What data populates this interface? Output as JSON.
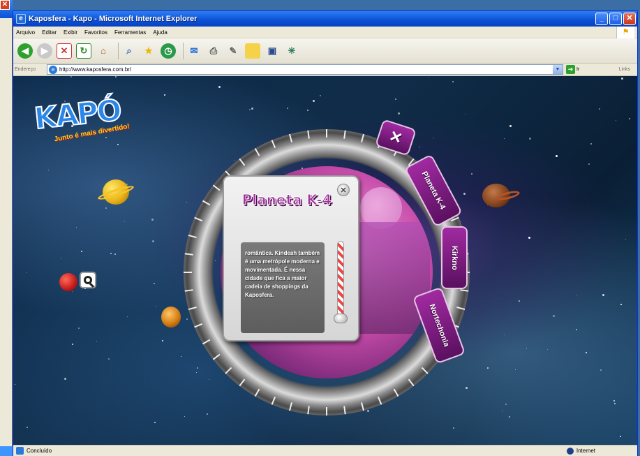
{
  "window": {
    "title": "Kaposfera - Kapo - Microsoft Internet Explorer",
    "minimize": "_",
    "maximize": "□",
    "close": "✕"
  },
  "menu": [
    "Arquivo",
    "Editar",
    "Exibir",
    "Favoritos",
    "Ferramentas",
    "Ajuda"
  ],
  "address": {
    "label": "Endereço",
    "url": "http://www.kaposfera.com.br/",
    "go_label": "Ir",
    "links_label": "Links"
  },
  "page": {
    "logo_word": "KAPÓ",
    "logo_tagline": "Junto é mais divertido!",
    "tabs": {
      "close": "✕",
      "planeta": "Planeta K-4",
      "kirkno": "Kirkno",
      "nortechonia": "Nortechonia"
    },
    "panel": {
      "title": "Planeta K-4",
      "close": "✕",
      "text": "romântica. Kindeah também é uma metrópole moderna e movimentada. É nessa cidade que fica a maior cadeia de shoppings da Kaposfera."
    }
  },
  "status": {
    "text": "Concluído",
    "zone": "Internet"
  }
}
